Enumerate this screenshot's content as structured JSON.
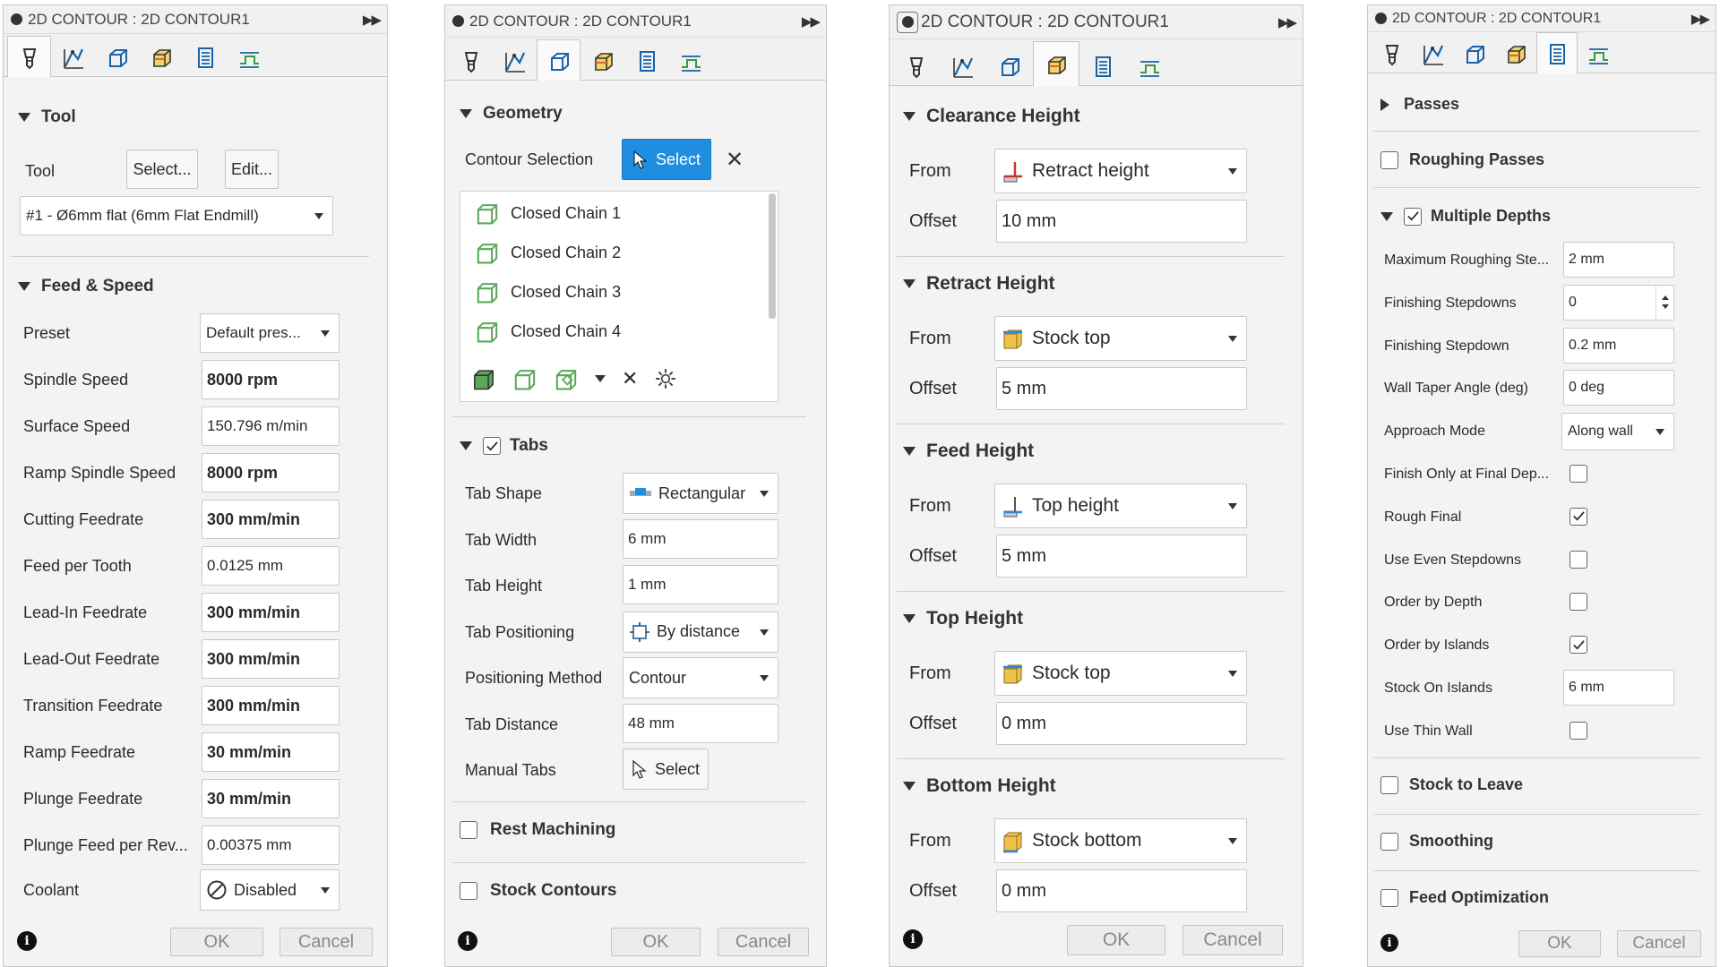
{
  "title": "2D CONTOUR : 2D CONTOUR1",
  "footer": {
    "ok": "OK",
    "cancel": "Cancel"
  },
  "panel1": {
    "tool_section": "Tool",
    "tool_label": "Tool",
    "select_btn": "Select...",
    "edit_btn": "Edit...",
    "tool_value": "#1 - Ø6mm flat (6mm Flat Endmill)",
    "feed_section": "Feed & Speed",
    "preset_label": "Preset",
    "preset_value": "Default pres...",
    "rows": [
      {
        "label": "Spindle Speed",
        "value": "8000 rpm",
        "bold": true
      },
      {
        "label": "Surface Speed",
        "value": "150.796 m/min",
        "bold": false
      },
      {
        "label": "Ramp Spindle Speed",
        "value": "8000 rpm",
        "bold": true
      },
      {
        "label": "Cutting Feedrate",
        "value": "300 mm/min",
        "bold": true
      },
      {
        "label": "Feed per Tooth",
        "value": "0.0125 mm",
        "bold": false
      },
      {
        "label": "Lead-In Feedrate",
        "value": "300 mm/min",
        "bold": true
      },
      {
        "label": "Lead-Out Feedrate",
        "value": "300 mm/min",
        "bold": true
      },
      {
        "label": "Transition Feedrate",
        "value": "300 mm/min",
        "bold": true
      },
      {
        "label": "Ramp Feedrate",
        "value": "30 mm/min",
        "bold": true
      },
      {
        "label": "Plunge Feedrate",
        "value": "30 mm/min",
        "bold": true
      },
      {
        "label": "Plunge Feed per Rev...",
        "value": "0.00375 mm",
        "bold": false
      }
    ],
    "coolant_label": "Coolant",
    "coolant_value": "Disabled"
  },
  "panel2": {
    "geometry_section": "Geometry",
    "contour_label": "Contour Selection",
    "select_btn": "Select",
    "chains": [
      "Closed Chain 1",
      "Closed Chain 2",
      "Closed Chain 3",
      "Closed Chain 4"
    ],
    "tabs_section": "Tabs",
    "rows": [
      {
        "label": "Tab Shape",
        "value": "Rectangular",
        "type": "dropdown",
        "icon": "rectangle-tab-icon"
      },
      {
        "label": "Tab Width",
        "value": "6 mm",
        "type": "field"
      },
      {
        "label": "Tab Height",
        "value": "1 mm",
        "type": "field"
      },
      {
        "label": "Tab Positioning",
        "value": "By distance",
        "type": "dropdown",
        "icon": "by-distance-icon"
      },
      {
        "label": "Positioning Method",
        "value": "Contour",
        "type": "dropdown"
      },
      {
        "label": "Tab Distance",
        "value": "48 mm",
        "type": "field"
      }
    ],
    "manual_label": "Manual Tabs",
    "manual_btn": "Select",
    "rest_section": "Rest Machining",
    "stock_section": "Stock Contours"
  },
  "panel3": {
    "sections": [
      {
        "title": "Clearance Height",
        "from": "Retract height",
        "offset": "10 mm",
        "icon": "retract-height-icon"
      },
      {
        "title": "Retract Height",
        "from": "Stock top",
        "offset": "5 mm",
        "icon": "stock-top-icon"
      },
      {
        "title": "Feed Height",
        "from": "Top height",
        "offset": "5 mm",
        "icon": "top-height-icon"
      },
      {
        "title": "Top Height",
        "from": "Stock top",
        "offset": "0 mm",
        "icon": "stock-top-icon"
      },
      {
        "title": "Bottom Height",
        "from": "Stock bottom",
        "offset": "0 mm",
        "icon": "stock-bottom-icon"
      }
    ],
    "from_label": "From",
    "offset_label": "Offset"
  },
  "panel4": {
    "passes": "Passes",
    "roughing": "Roughing Passes",
    "multiple": "Multiple Depths",
    "rows": [
      {
        "label": "Maximum Roughing Ste...",
        "type": "field",
        "value": "2 mm"
      },
      {
        "label": "Finishing Stepdowns",
        "type": "spin",
        "value": "0"
      },
      {
        "label": "Finishing Stepdown",
        "type": "field",
        "value": "0.2 mm"
      },
      {
        "label": "Wall Taper Angle (deg)",
        "type": "field",
        "value": "0 deg"
      },
      {
        "label": "Approach Mode",
        "type": "dropdown",
        "value": "Along wall"
      },
      {
        "label": "Finish Only at Final Dep...",
        "type": "check",
        "checked": false
      },
      {
        "label": "Rough Final",
        "type": "check",
        "checked": true
      },
      {
        "label": "Use Even Stepdowns",
        "type": "check",
        "checked": false
      },
      {
        "label": "Order by Depth",
        "type": "check",
        "checked": false
      },
      {
        "label": "Order by Islands",
        "type": "check",
        "checked": true
      },
      {
        "label": "Stock On Islands",
        "type": "field",
        "value": "6 mm"
      },
      {
        "label": "Use Thin Wall",
        "type": "check",
        "checked": false
      }
    ],
    "stock_leave": "Stock to Leave",
    "smoothing": "Smoothing",
    "feed_opt": "Feed Optimization"
  }
}
